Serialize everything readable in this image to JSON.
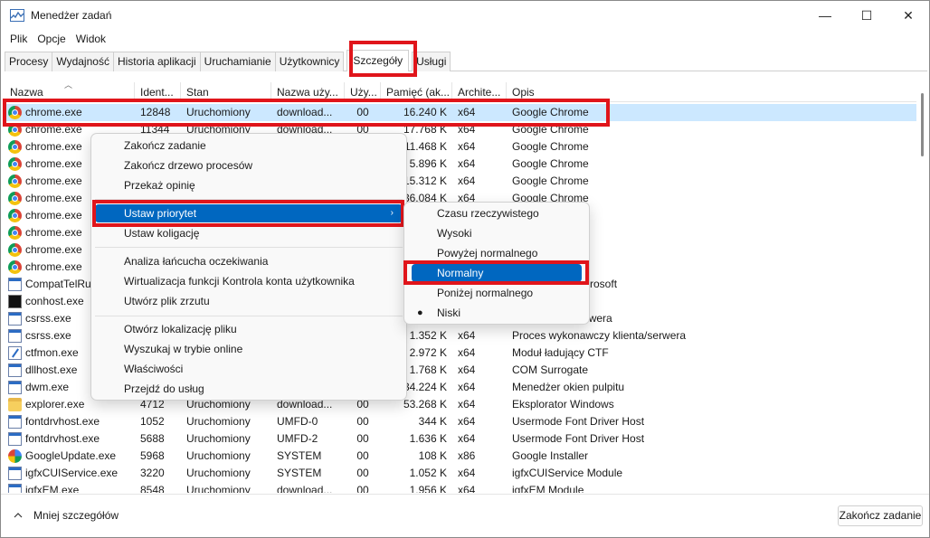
{
  "window": {
    "title": "Menedżer zadań",
    "minimize": "—",
    "maximize": "☐",
    "close": "✕"
  },
  "menu": [
    "Plik",
    "Opcje",
    "Widok"
  ],
  "tabs": [
    "Procesy",
    "Wydajność",
    "Historia aplikacji",
    "Uruchamianie",
    "Użytkownicy",
    "Szczegóły",
    "Usługi"
  ],
  "active_tab": "Szczegóły",
  "columns": [
    "Nazwa",
    "Ident...",
    "Stan",
    "Nazwa uży...",
    "Uży...",
    "Pamięć (ak...",
    "Archite...",
    "Opis"
  ],
  "rows": [
    {
      "icon": "chrome-icon",
      "name": "chrome.exe",
      "pid": "12848",
      "status": "Uruchomiony",
      "user": "download...",
      "cpu": "00",
      "mem": "16.240 K",
      "arch": "x64",
      "desc": "Google Chrome"
    },
    {
      "icon": "chrome-icon",
      "name": "chrome.exe",
      "pid": "11344",
      "status": "Uruchomiony",
      "user": "download...",
      "cpu": "00",
      "mem": "17.768 K",
      "arch": "x64",
      "desc": "Google Chrome"
    },
    {
      "icon": "chrome-icon",
      "name": "chrome.exe",
      "pid": "",
      "status": "",
      "user": "",
      "cpu": "",
      "mem": "11.468 K",
      "arch": "x64",
      "desc": "Google Chrome"
    },
    {
      "icon": "chrome-icon",
      "name": "chrome.exe",
      "pid": "",
      "status": "",
      "user": "",
      "cpu": "",
      "mem": "5.896 K",
      "arch": "x64",
      "desc": "Google Chrome"
    },
    {
      "icon": "chrome-icon",
      "name": "chrome.exe",
      "pid": "",
      "status": "",
      "user": "",
      "cpu": "",
      "mem": "15.312 K",
      "arch": "x64",
      "desc": "Google Chrome"
    },
    {
      "icon": "chrome-icon",
      "name": "chrome.exe",
      "pid": "",
      "status": "",
      "user": "",
      "cpu": "",
      "mem": "36.084 K",
      "arch": "x64",
      "desc": "Google Chrome"
    },
    {
      "icon": "chrome-icon",
      "name": "chrome.exe",
      "pid": "",
      "status": "",
      "user": "",
      "cpu": "",
      "mem": "",
      "arch": "",
      "desc": ""
    },
    {
      "icon": "chrome-icon",
      "name": "chrome.exe",
      "pid": "",
      "status": "",
      "user": "",
      "cpu": "",
      "mem": "",
      "arch": "",
      "desc": ""
    },
    {
      "icon": "chrome-icon",
      "name": "chrome.exe",
      "pid": "",
      "status": "",
      "user": "",
      "cpu": "",
      "mem": "",
      "arch": "",
      "desc": ""
    },
    {
      "icon": "chrome-icon",
      "name": "chrome.exe",
      "pid": "",
      "status": "",
      "user": "",
      "cpu": "",
      "mem": "",
      "arch": "",
      "desc": ""
    },
    {
      "icon": "window-icon",
      "name": "CompatTelRu",
      "pid": "",
      "status": "",
      "user": "",
      "cpu": "",
      "mem": "",
      "arch": "",
      "desc": "nności firmy Microsoft"
    },
    {
      "icon": "console-icon",
      "name": "conhost.exe",
      "pid": "",
      "status": "",
      "user": "",
      "cpu": "",
      "mem": "",
      "arch": "",
      "desc": "oli"
    },
    {
      "icon": "window-icon",
      "name": "csrss.exe",
      "pid": "",
      "status": "",
      "user": "",
      "cpu": "",
      "mem": "",
      "arch": "",
      "desc": "wczy klienta/serwera"
    },
    {
      "icon": "window-icon",
      "name": "csrss.exe",
      "pid": "",
      "status": "",
      "user": "",
      "cpu": "",
      "mem": "1.352 K",
      "arch": "x64",
      "desc": "Proces wykonawczy klienta/serwera"
    },
    {
      "icon": "pen-icon",
      "name": "ctfmon.exe",
      "pid": "",
      "status": "",
      "user": "",
      "cpu": "",
      "mem": "2.972 K",
      "arch": "x64",
      "desc": "Moduł ładujący CTF"
    },
    {
      "icon": "window-icon",
      "name": "dllhost.exe",
      "pid": "",
      "status": "",
      "user": "",
      "cpu": "",
      "mem": "1.768 K",
      "arch": "x64",
      "desc": "COM Surrogate"
    },
    {
      "icon": "window-icon",
      "name": "dwm.exe",
      "pid": "",
      "status": "",
      "user": "",
      "cpu": "",
      "mem": "34.224 K",
      "arch": "x64",
      "desc": "Menedżer okien pulpitu"
    },
    {
      "icon": "folder-icon",
      "name": "explorer.exe",
      "pid": "4712",
      "status": "Uruchomiony",
      "user": "download...",
      "cpu": "00",
      "mem": "53.268 K",
      "arch": "x64",
      "desc": "Eksplorator Windows"
    },
    {
      "icon": "window-icon",
      "name": "fontdrvhost.exe",
      "pid": "1052",
      "status": "Uruchomiony",
      "user": "UMFD-0",
      "cpu": "00",
      "mem": "344 K",
      "arch": "x64",
      "desc": "Usermode Font Driver Host"
    },
    {
      "icon": "window-icon",
      "name": "fontdrvhost.exe",
      "pid": "5688",
      "status": "Uruchomiony",
      "user": "UMFD-2",
      "cpu": "00",
      "mem": "1.636 K",
      "arch": "x64",
      "desc": "Usermode Font Driver Host"
    },
    {
      "icon": "google-icon",
      "name": "GoogleUpdate.exe",
      "pid": "5968",
      "status": "Uruchomiony",
      "user": "SYSTEM",
      "cpu": "00",
      "mem": "108 K",
      "arch": "x86",
      "desc": "Google Installer"
    },
    {
      "icon": "window-icon",
      "name": "igfxCUIService.exe",
      "pid": "3220",
      "status": "Uruchomiony",
      "user": "SYSTEM",
      "cpu": "00",
      "mem": "1.052 K",
      "arch": "x64",
      "desc": "igfxCUIService Module"
    },
    {
      "icon": "window-icon",
      "name": "igfxEM.exe",
      "pid": "8548",
      "status": "Uruchomiony",
      "user": "download...",
      "cpu": "00",
      "mem": "1.956 K",
      "arch": "x64",
      "desc": "igfxEM Module"
    }
  ],
  "context_menu": {
    "group1": [
      "Zakończ zadanie",
      "Zakończ drzewo procesów",
      "Przekaż opinię"
    ],
    "group2": [
      "Ustaw priorytet",
      "Ustaw koligację"
    ],
    "group3": [
      "Analiza łańcucha oczekiwania",
      "Wirtualizacja funkcji Kontrola konta użytkownika",
      "Utwórz plik zrzutu"
    ],
    "group4": [
      "Otwórz lokalizację pliku",
      "Wyszukaj w trybie online",
      "Właściwości",
      "Przejdź do usług"
    ],
    "submenu_arrow": "›"
  },
  "priority_menu": {
    "items": [
      "Czasu rzeczywistego",
      "Wysoki",
      "Powyżej normalnego",
      "Normalny",
      "Poniżej normalnego",
      "Niski"
    ],
    "highlighted": "Normalny",
    "checked": "Niski",
    "bullet": "●"
  },
  "footer": {
    "less_details": "Mniej szczegółów",
    "end_task": "Zakończ zadanie"
  },
  "colors": {
    "highlight_red": "#e0151b",
    "selection_blue": "#0067c0",
    "row_selected": "#cce8ff"
  }
}
